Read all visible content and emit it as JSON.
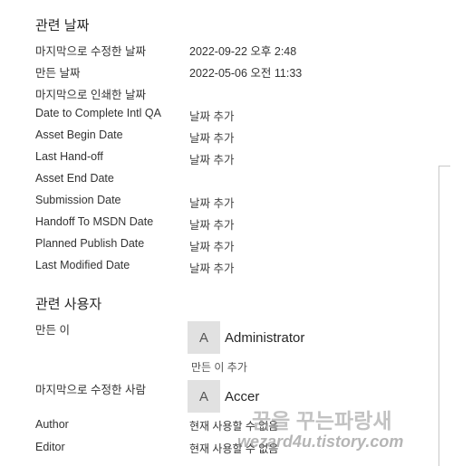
{
  "dates_section": {
    "title": "관련 날짜",
    "rows": [
      {
        "label": "마지막으로 수정한 날짜",
        "value": "2022-09-22 오후 2:48"
      },
      {
        "label": "만든 날짜",
        "value": "2022-05-06 오전 11:33"
      },
      {
        "label": "마지막으로 인쇄한 날짜",
        "value": ""
      },
      {
        "label": "Date to Complete Intl QA",
        "value": "날짜 추가"
      },
      {
        "label": "Asset Begin Date",
        "value": "날짜 추가"
      },
      {
        "label": "Last Hand-off",
        "value": "날짜 추가"
      },
      {
        "label": "Asset End Date",
        "value": ""
      },
      {
        "label": "Submission Date",
        "value": "날짜 추가"
      },
      {
        "label": "Handoff To MSDN Date",
        "value": "날짜 추가"
      },
      {
        "label": "Planned Publish Date",
        "value": "날짜 추가"
      },
      {
        "label": "Last Modified Date",
        "value": "날짜 추가"
      }
    ]
  },
  "people_section": {
    "title": "관련 사용자",
    "created_by": {
      "label": "만든 이",
      "avatar_letter": "A",
      "name": "Administrator",
      "add_label": "만든 이 추가"
    },
    "last_modified_by": {
      "label": "마지막으로 수정한 사람",
      "avatar_letter": "A",
      "name": "Accer"
    },
    "author": {
      "label": "Author",
      "value": "현재 사용할 수 없음"
    },
    "editor": {
      "label": "Editor",
      "value": "현재 사용할 수 없음"
    }
  },
  "watermark": {
    "line1": "꿈을 꾸는파랑새",
    "line2": "wezard4u.tistory.com"
  }
}
